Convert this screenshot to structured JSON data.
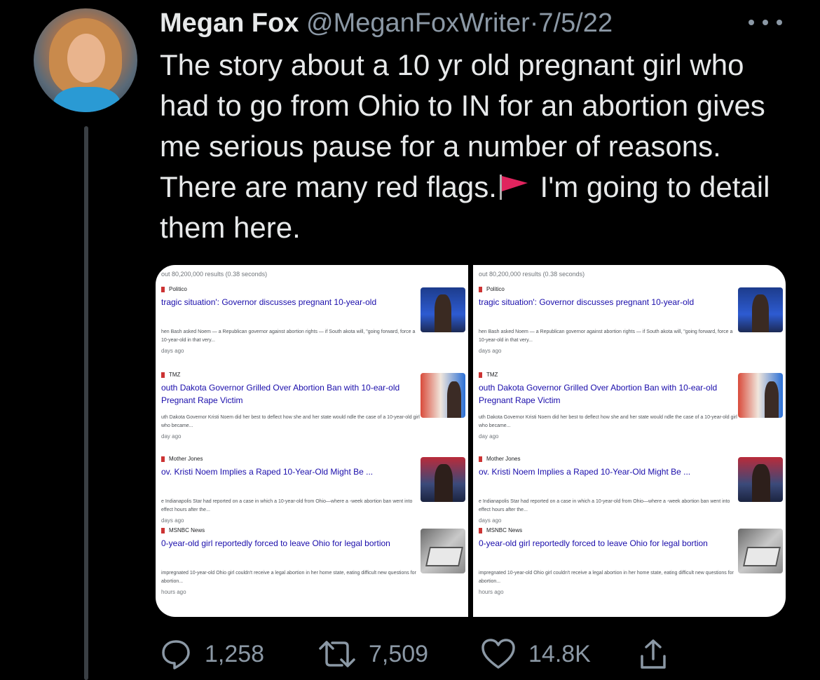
{
  "tweet": {
    "author_name": "Megan Fox",
    "handle": "@MeganFoxWriter",
    "separator": "·",
    "date": "7/5/22",
    "text_before_flag": "The story about a 10 yr old pregnant girl who had to go from Ohio to IN for an abortion gives me serious pause for a number of reasons. There are many red flags.",
    "text_after_flag": " I'm going to detail them here.",
    "flag_icon": "red-flag-icon"
  },
  "actions": {
    "replies": "1,258",
    "retweets": "7,509",
    "likes": "14.8K"
  },
  "screenshot": {
    "result_count": "out 80,200,000 results (0.38 seconds)",
    "results": [
      {
        "source": "Politico",
        "title": "tragic situation': Governor discusses pregnant 10-year-old",
        "snippet": "hen Bash asked Noem — a Republican governor against abortion rights — if South akota will, \"going forward, force a 10-year-old in that very...",
        "ago": "days ago"
      },
      {
        "source": "TMZ",
        "title": "outh Dakota Governor Grilled Over Abortion Ban with 10-ear-old Pregnant Rape Victim",
        "snippet": "uth Dakota Governor Kristi Noem did her best to deflect how she and her state would ndle the case of a 10-year-old girl who became...",
        "ago": "day ago"
      },
      {
        "source": "Mother Jones",
        "title": "ov. Kristi Noem Implies a Raped 10-Year-Old Might Be ...",
        "snippet": "e Indianapolis Star had reported on a case in which a 10-year-old from Ohio—where a -week abortion ban went into effect hours after the...",
        "ago": "days ago"
      },
      {
        "source": "MSNBC News",
        "title": "0-year-old girl reportedly forced to leave Ohio for legal bortion",
        "snippet": "impregnated 10-year-old Ohio girl couldn't receive a legal abortion in her home state, eating difficult new questions for abortion...",
        "ago": "hours ago"
      }
    ]
  },
  "colors": {
    "background": "#000000",
    "text": "#e7e9ea",
    "secondary": "#8b98a5",
    "link": "#1a0dab",
    "flag_red": "#e0245e"
  }
}
